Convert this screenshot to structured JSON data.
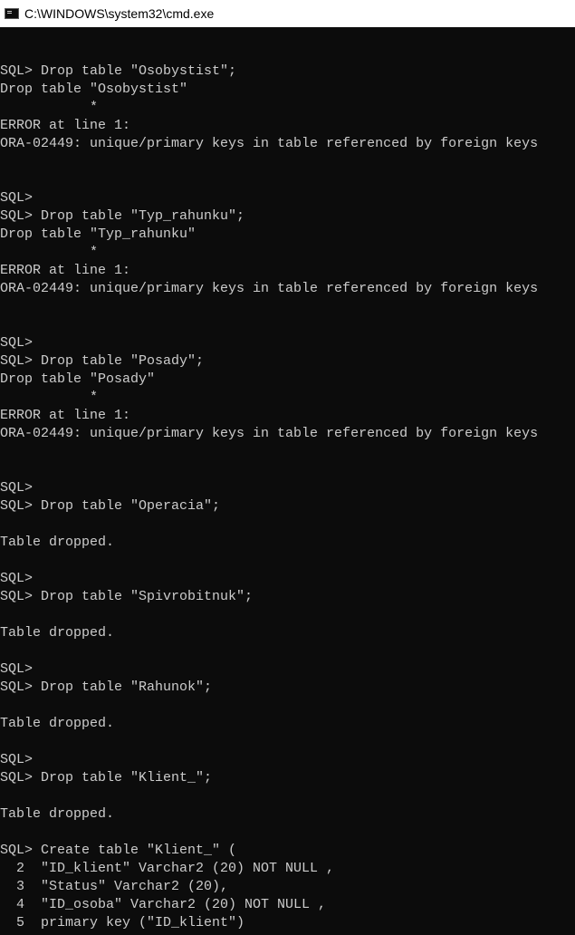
{
  "window": {
    "title": "C:\\WINDOWS\\system32\\cmd.exe",
    "icon": "cmd-icon"
  },
  "console": {
    "lines": [
      "",
      "",
      "SQL> Drop table \"Osobystist\";",
      "Drop table \"Osobystist\"",
      "           *",
      "ERROR at line 1:",
      "ORA-02449: unique/primary keys in table referenced by foreign keys",
      "",
      "",
      "SQL>",
      "SQL> Drop table \"Typ_rahunku\";",
      "Drop table \"Typ_rahunku\"",
      "           *",
      "ERROR at line 1:",
      "ORA-02449: unique/primary keys in table referenced by foreign keys",
      "",
      "",
      "SQL>",
      "SQL> Drop table \"Posady\";",
      "Drop table \"Posady\"",
      "           *",
      "ERROR at line 1:",
      "ORA-02449: unique/primary keys in table referenced by foreign keys",
      "",
      "",
      "SQL>",
      "SQL> Drop table \"Operacia\";",
      "",
      "Table dropped.",
      "",
      "SQL>",
      "SQL> Drop table \"Spivrobitnuk\";",
      "",
      "Table dropped.",
      "",
      "SQL>",
      "SQL> Drop table \"Rahunok\";",
      "",
      "Table dropped.",
      "",
      "SQL>",
      "SQL> Drop table \"Klient_\";",
      "",
      "Table dropped.",
      "",
      "SQL> Create table \"Klient_\" (",
      "  2  \"ID_klient\" Varchar2 (20) NOT NULL ,",
      "  3  \"Status\" Varchar2 (20),",
      "  4  \"ID_osoba\" Varchar2 (20) NOT NULL ,",
      "  5  primary key (\"ID_klient\")"
    ]
  }
}
